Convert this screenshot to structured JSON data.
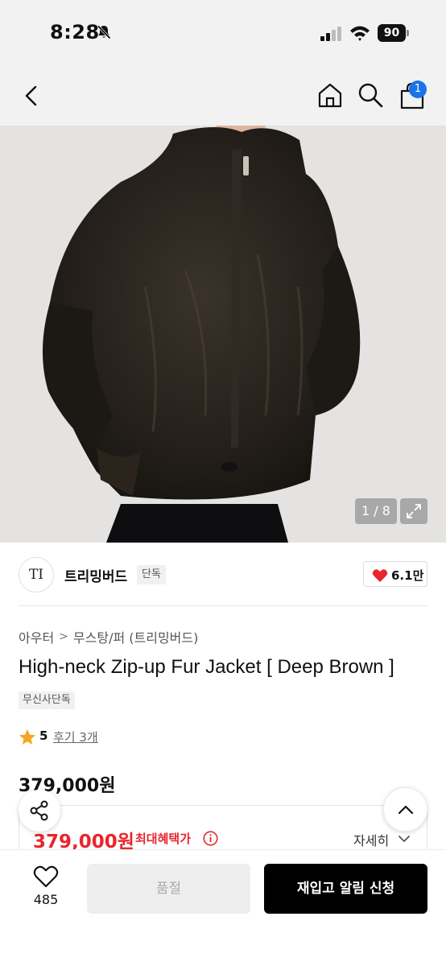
{
  "status_bar": {
    "time": "8:28",
    "battery": "90",
    "icons": [
      "bell-slash-icon",
      "signal-icon",
      "wifi-icon",
      "battery-icon"
    ]
  },
  "nav": {
    "icons": [
      "back-chevron-icon",
      "home-icon",
      "search-icon",
      "cart-icon"
    ],
    "cart_badge": "1"
  },
  "gallery": {
    "counter": "1 / 8",
    "expand_icon": "expand-icon"
  },
  "brand": {
    "logo_text": "TI",
    "name": "트리밍버드",
    "tag": "단독",
    "like_count": "6.1만"
  },
  "product": {
    "breadcrumb": [
      "아우터",
      "무스탕/퍼 (트리밍버드)"
    ],
    "title": "High-neck Zip-up Fur Jacket [ Deep Brown ]",
    "exclusive_tag": "무신사단독",
    "rating": "5",
    "review_link": "후기 3개",
    "price": "379,000원",
    "sale_price": "379,000원",
    "max_benefit_label": "최대혜택가",
    "detail_link": "자세히"
  },
  "bottom_bar": {
    "wish_count": "485",
    "soldout_label": "품절",
    "restock_label": "재입고 알림 신청"
  },
  "colors": {
    "accent_red": "#e8262c",
    "badge_blue": "#1a73e8",
    "cta_black": "#000000"
  }
}
